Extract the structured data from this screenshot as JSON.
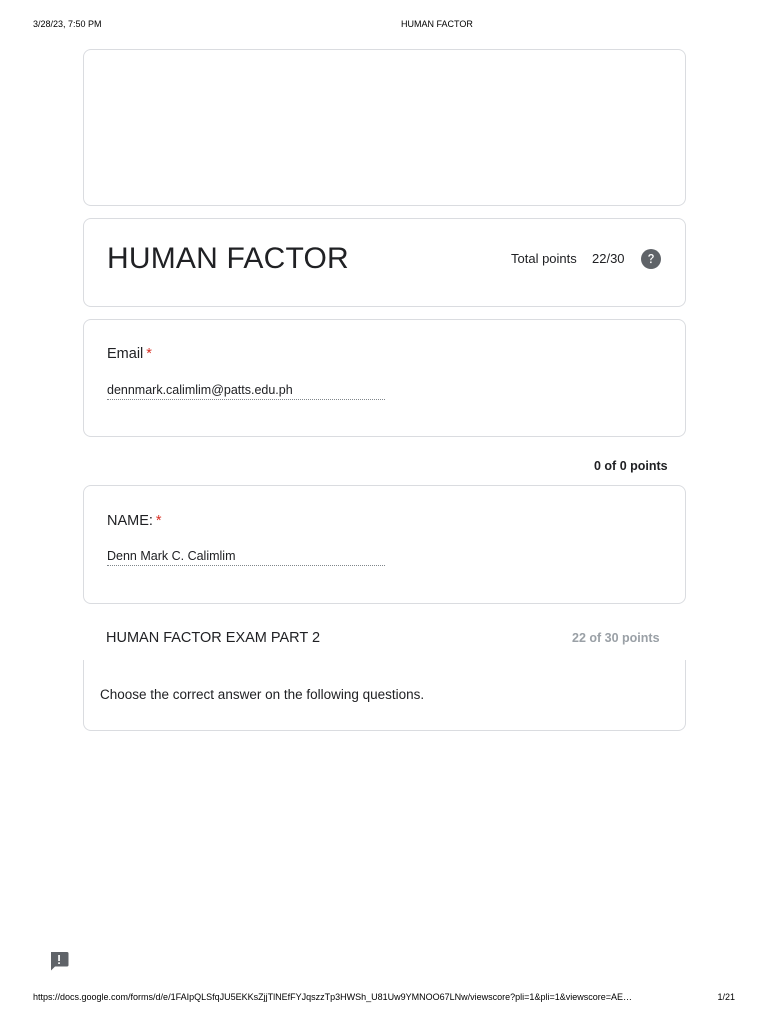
{
  "print_header": {
    "datetime": "3/28/23, 7:50 PM",
    "title": "HUMAN FACTOR"
  },
  "form": {
    "title": "HUMAN FACTOR",
    "total_points_label": "Total points",
    "total_points_value": "22/30"
  },
  "email_question": {
    "label": "Email",
    "required_mark": "*",
    "answer": "dennmark.calimlim@patts.edu.ph"
  },
  "section_points": "0 of 0 points",
  "name_question": {
    "label": "NAME:",
    "required_mark": "*",
    "answer": "Denn Mark C. Calimlim"
  },
  "section": {
    "title": "HUMAN FACTOR EXAM PART 2",
    "score": "22 of 30 points",
    "description": "Choose the correct answer on the following questions."
  },
  "print_footer": {
    "url": "https://docs.google.com/forms/d/e/1FAIpQLSfqJU5EKKsZjjTlNEfFYJqszzTp3HWSh_U81Uw9YMNOO67LNw/viewscore?pli=1&pli=1&viewscore=AE…",
    "page": "1/21"
  },
  "icons": {
    "help": "help-circle-icon",
    "feedback": "feedback-icon"
  },
  "colors": {
    "required": "#d93025",
    "border": "#dadce0",
    "muted_points": "#9aa0a6",
    "icon_gray": "#5f6368"
  }
}
